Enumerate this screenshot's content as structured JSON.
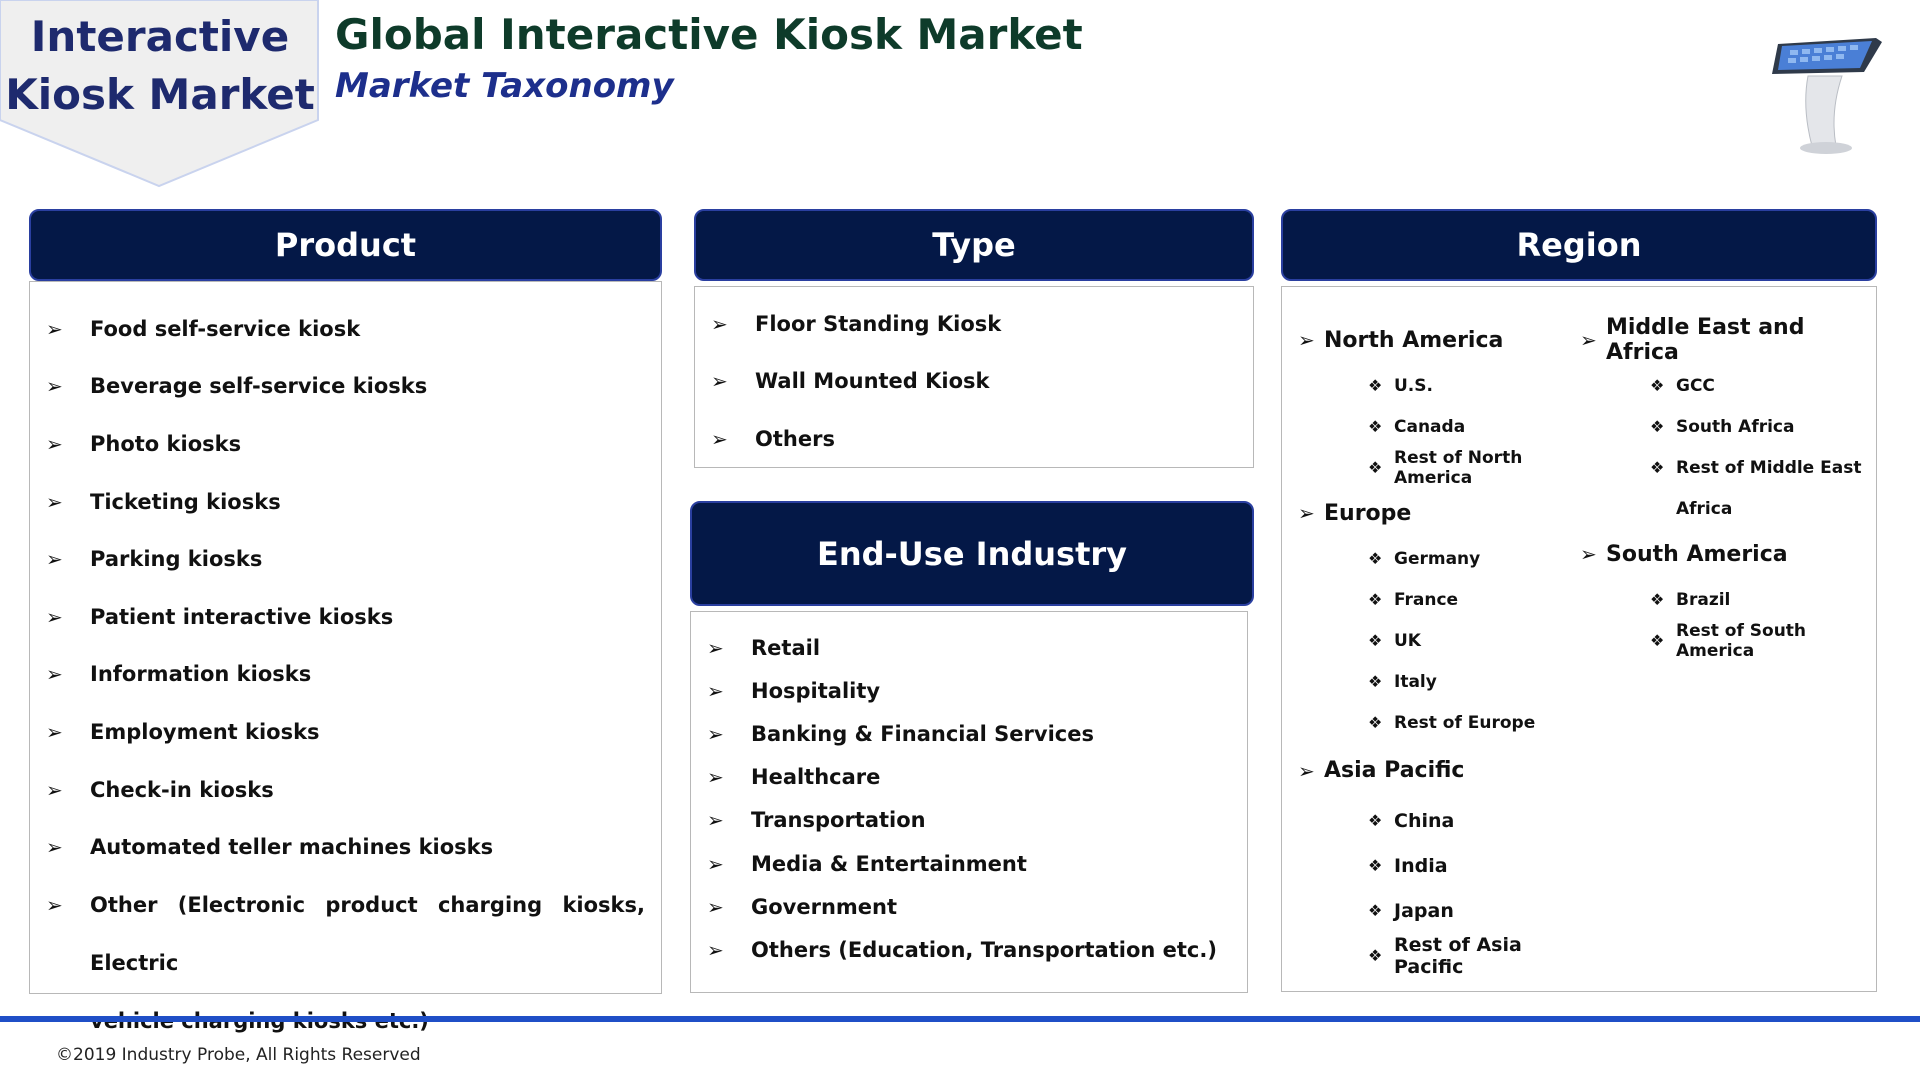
{
  "header": {
    "tag_line1": "Interactive",
    "tag_line2": "Kiosk Market",
    "title": "Global Interactive Kiosk Market",
    "subtitle": "Market Taxonomy"
  },
  "product": {
    "heading": "Product",
    "items": [
      "Food self-service kiosk",
      "Beverage self-service kiosks",
      "Photo kiosks",
      "Ticketing kiosks",
      "Parking kiosks",
      "Patient interactive kiosks",
      "Information kiosks",
      "Employment kiosks",
      "Check-in kiosks",
      "Automated teller machines kiosks"
    ],
    "other_line1": "Other (Electronic product charging kiosks, Electric",
    "other_line2": "vehicle charging kiosks etc.)"
  },
  "type": {
    "heading": "Type",
    "items": [
      "Floor Standing Kiosk",
      "Wall Mounted Kiosk",
      "Others"
    ]
  },
  "end_use": {
    "heading": "End-Use Industry",
    "items": [
      "Retail",
      "Hospitality",
      "Banking & Financial Services",
      "Healthcare",
      "Transportation",
      "Media & Entertainment",
      "Government",
      "Others (Education, Transportation etc.)"
    ]
  },
  "region": {
    "heading": "Region",
    "north_america": {
      "label": "North America",
      "countries": [
        "U.S.",
        "Canada",
        "Rest of North America"
      ]
    },
    "europe": {
      "label": "Europe",
      "countries": [
        "Germany",
        "France",
        "UK",
        "Italy",
        "Rest of Europe"
      ]
    },
    "asia_pacific": {
      "label": "Asia Pacific",
      "countries": [
        "China",
        "India",
        "Japan",
        "Rest of Asia Pacific"
      ]
    },
    "mea": {
      "label": "Middle East and Africa",
      "countries": [
        "GCC",
        "South Africa",
        "Rest of Middle East"
      ],
      "continuation": "Africa"
    },
    "south_america": {
      "label": "South America",
      "countries": [
        "Brazil",
        "Rest of South America"
      ]
    }
  },
  "footer": {
    "copyright": "©2019 Industry Probe, All Rights Reserved"
  },
  "colors": {
    "header_bg": "#041847",
    "footer_line": "#1f4fc7",
    "tag_text": "#1e2a6e",
    "title": "#0e3b2a",
    "subtitle": "#1d2f8c"
  },
  "icons": {
    "bullet": "arrowhead-icon",
    "sub_bullet": "diamond-cluster-icon",
    "image": "kiosk-icon"
  }
}
